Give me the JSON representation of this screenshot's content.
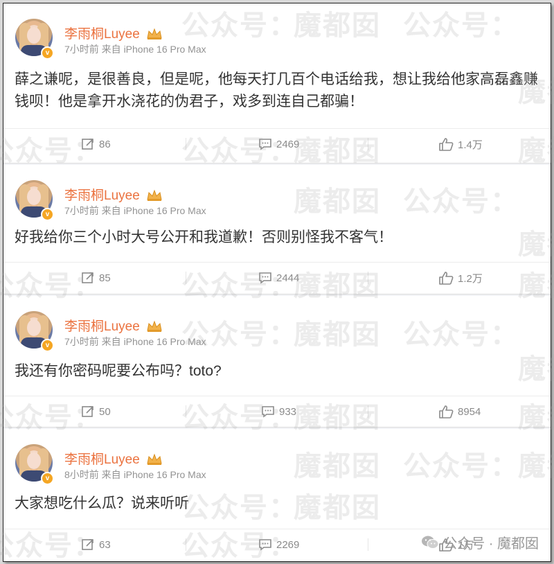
{
  "posts": [
    {
      "username": "李雨桐Luyee",
      "meta": "7小时前 来自 iPhone 16 Pro Max",
      "content": "薛之谦呢，是很善良，但是呢，他每天打几百个电话给我，想让我给他家高磊鑫赚钱呗！他是拿开水浇花的伪君子，戏多到连自己都骗！",
      "repost": "86",
      "comments": "2469",
      "likes": "1.4万"
    },
    {
      "username": "李雨桐Luyee",
      "meta": "7小时前 来自 iPhone 16 Pro Max",
      "content": "好我给你三个小时大号公开和我道歉！否则别怪我不客气！",
      "repost": "85",
      "comments": "2444",
      "likes": "1.2万"
    },
    {
      "username": "李雨桐Luyee",
      "meta": "7小时前 来自 iPhone 16 Pro Max",
      "content": "我还有你密码呢要公布吗？toto?",
      "repost": "50",
      "comments": "933",
      "likes": "8954"
    },
    {
      "username": "李雨桐Luyee",
      "meta": "8小时前 来自 iPhone 16 Pro Max",
      "content": "大家想吃什么瓜？说来听听",
      "repost": "63",
      "comments": "2269",
      "likes": "1万"
    }
  ],
  "watermark": {
    "text_a": "公众号：",
    "text_b": "魔都囡"
  },
  "brand": {
    "label": "公众号 · 魔都囡"
  },
  "colors": {
    "username": "#eb7340",
    "verified_badge": "#f5a623",
    "background": "#f1f2f5"
  },
  "icons": [
    "repost-icon",
    "comment-icon",
    "like-icon",
    "crown-icon",
    "verified-icon",
    "wechat-icon"
  ]
}
